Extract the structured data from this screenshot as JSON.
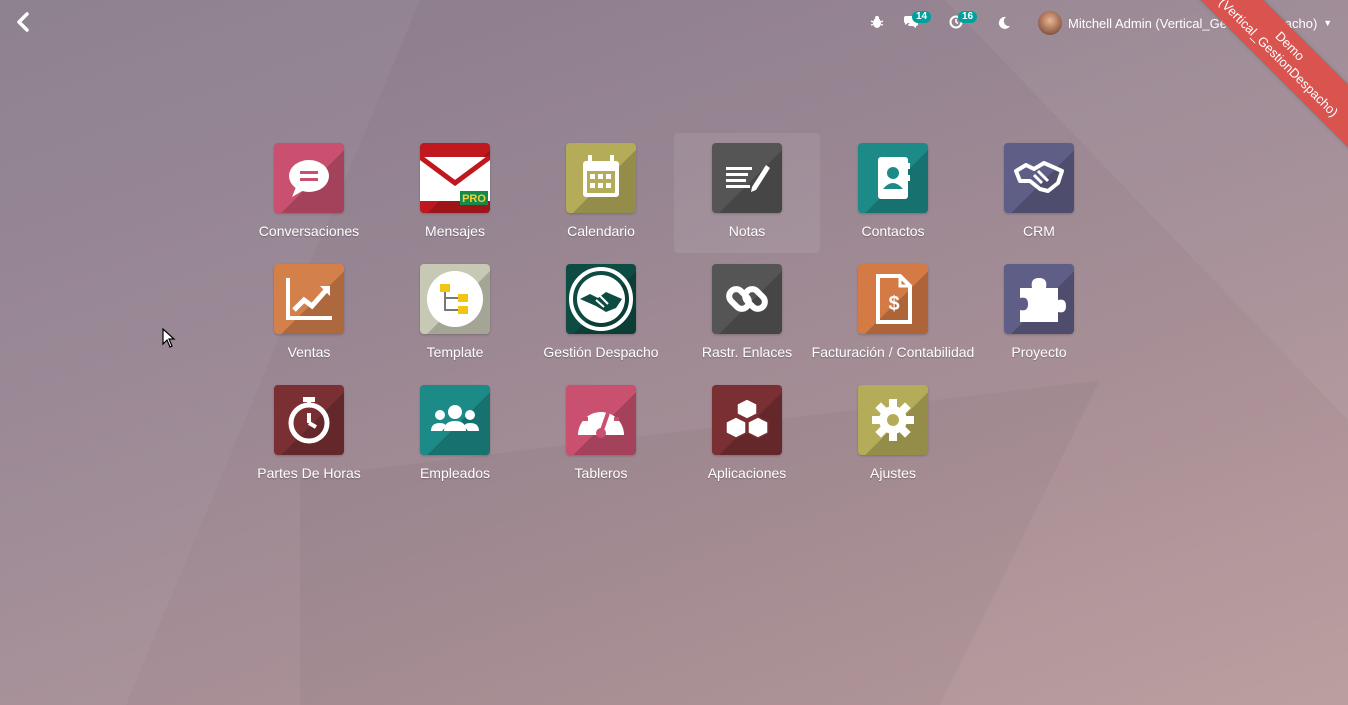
{
  "navbar": {
    "user_name": "Mitchell Admin (Vertical_GestionDespacho)",
    "messages_count": "14",
    "activities_count": "16"
  },
  "ribbon": {
    "text_line1": "Demo",
    "text_line2": "(Vertical_GestionDespacho)"
  },
  "apps": [
    {
      "label": "Conversaciones",
      "color": "#c9506f",
      "icon": "chat-bubble-icon"
    },
    {
      "label": "Mensajes",
      "color": "#c0181f",
      "icon": "envelope-pro-icon",
      "pro_badge": "PRO"
    },
    {
      "label": "Calendario",
      "color": "#b5ac5a",
      "icon": "calendar-icon"
    },
    {
      "label": "Notas",
      "color": "#555555",
      "icon": "notes-pencil-icon"
    },
    {
      "label": "Contactos",
      "color": "#1c8a86",
      "icon": "address-book-icon"
    },
    {
      "label": "CRM",
      "color": "#5f5e86",
      "icon": "handshake-icon"
    },
    {
      "label": "Ventas",
      "color": "#d3804a",
      "icon": "trend-chart-icon"
    },
    {
      "label": "Template",
      "color": "#c8c9b4",
      "icon": "hierarchy-icon"
    },
    {
      "label": "Gestión Despacho",
      "color": "#0e4b43",
      "icon": "handshake-circle-icon"
    },
    {
      "label": "Rastr. Enlaces",
      "color": "#555555",
      "icon": "link-icon"
    },
    {
      "label": "Facturación / Contabilidad",
      "color": "#d37a45",
      "icon": "invoice-dollar-icon"
    },
    {
      "label": "Proyecto",
      "color": "#5f5e86",
      "icon": "puzzle-icon"
    },
    {
      "label": "Partes De Horas",
      "color": "#7a2f33",
      "icon": "stopwatch-icon"
    },
    {
      "label": "Empleados",
      "color": "#1c8a86",
      "icon": "team-icon"
    },
    {
      "label": "Tableros",
      "color": "#c9506f",
      "icon": "gauge-icon"
    },
    {
      "label": "Aplicaciones",
      "color": "#7a2f33",
      "icon": "cubes-icon"
    },
    {
      "label": "Ajustes",
      "color": "#b5ac5a",
      "icon": "gear-icon"
    }
  ]
}
